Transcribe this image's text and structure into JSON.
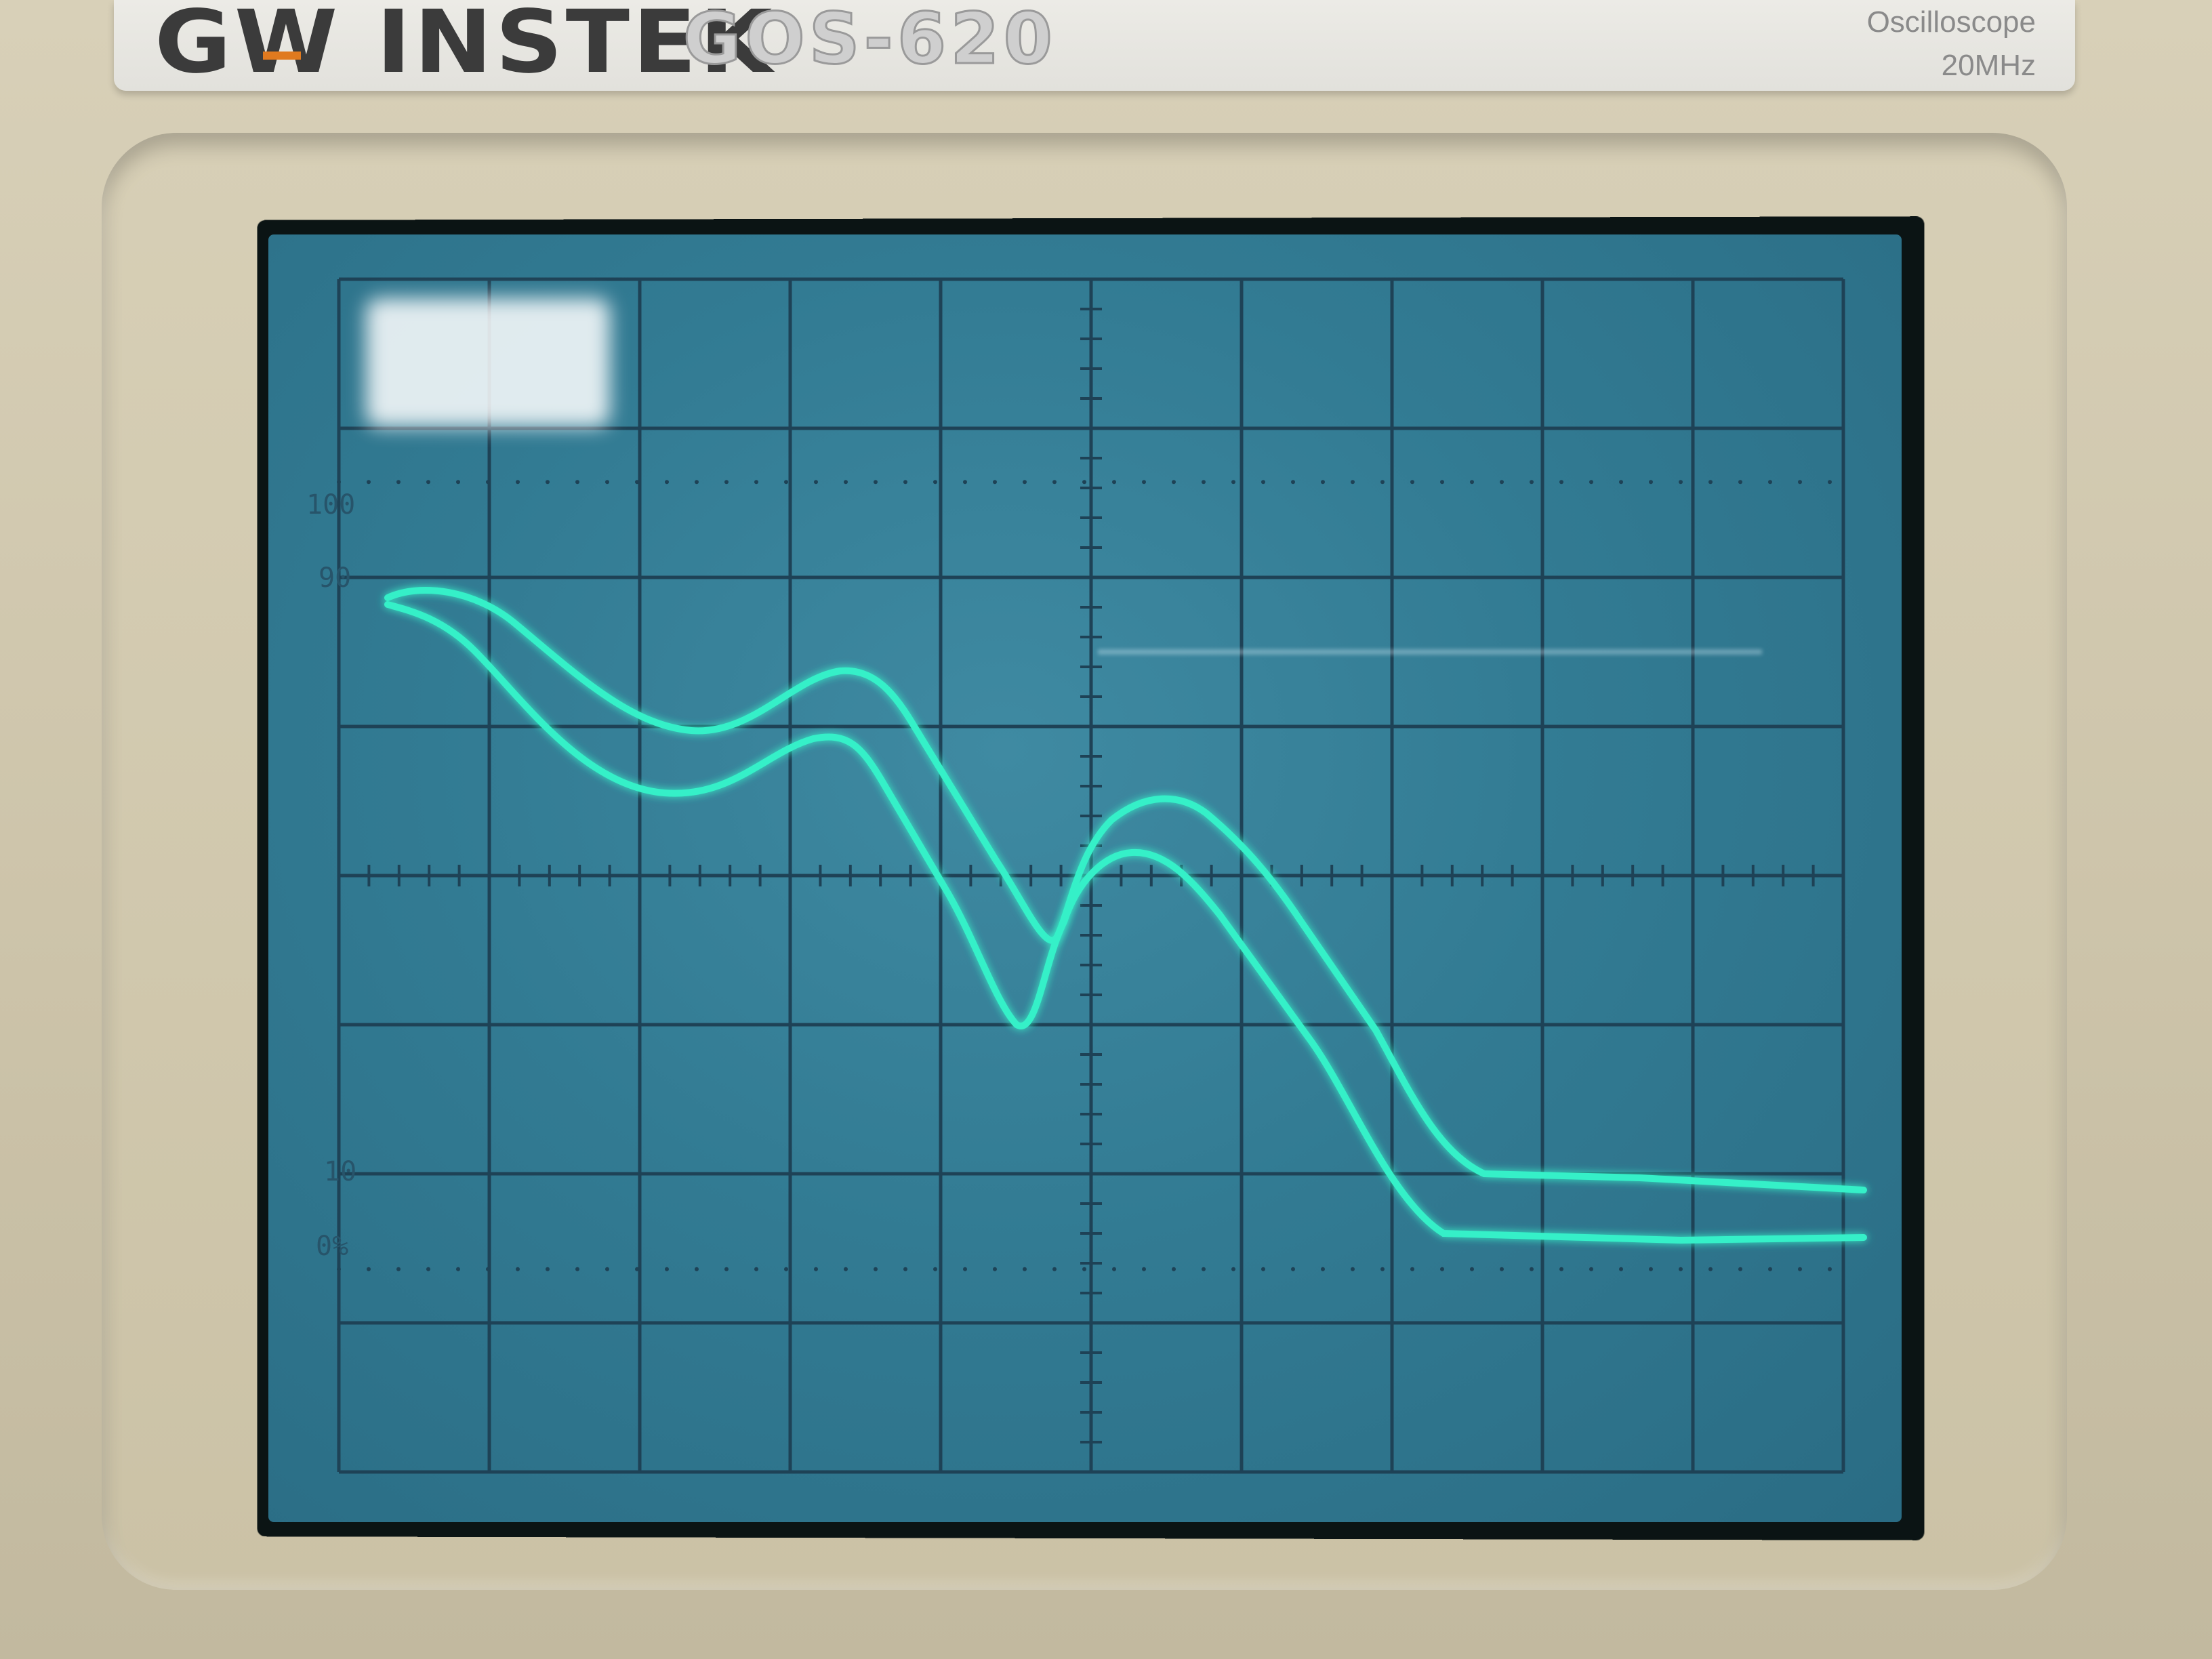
{
  "device": {
    "brand": "GW INSTEK",
    "model": "GOS-620",
    "kind": "Oscilloscope",
    "bandwidth": "20MHz"
  },
  "graticule_labels": {
    "top": "100",
    "ninety": "90",
    "ten": "10",
    "zero": "0%"
  },
  "colors": {
    "trace": "#35f0c8",
    "grid": "#1e4256",
    "screen": "#327b93"
  }
}
